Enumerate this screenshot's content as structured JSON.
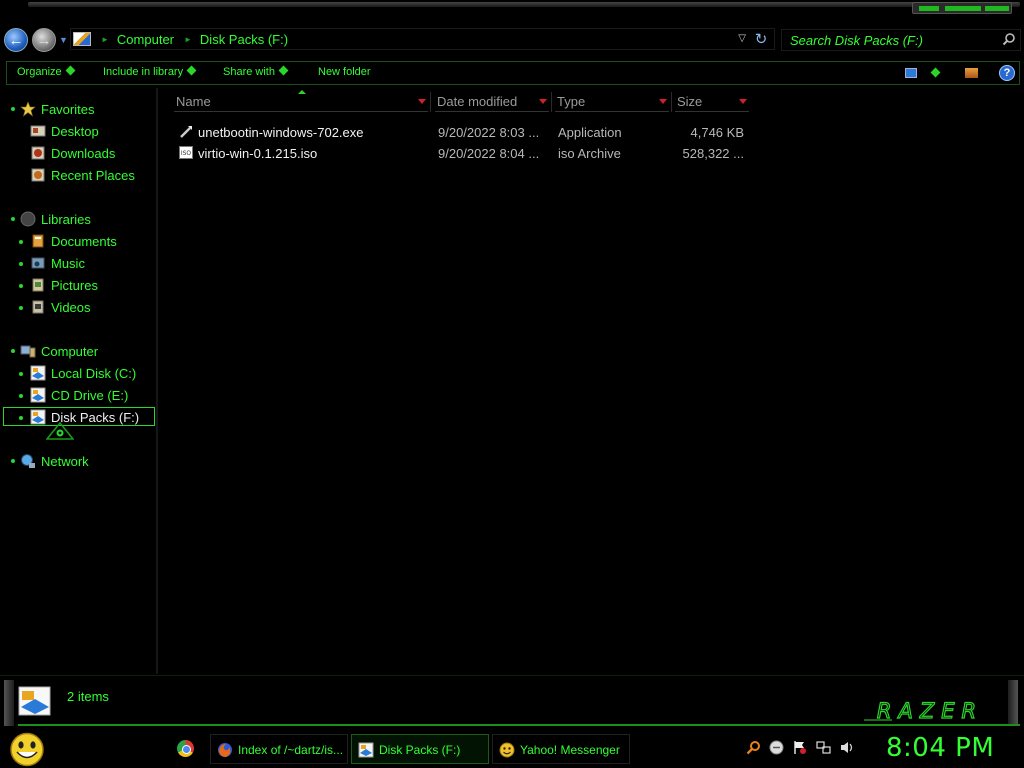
{
  "window": {
    "address_breadcrumbs": [
      "Computer",
      "Disk Packs (F:)"
    ],
    "search_placeholder": "Search Disk Packs (F:)"
  },
  "command_bar": {
    "organize": "Organize",
    "include_in_library": "Include in library",
    "share_with": "Share with",
    "new_folder": "New folder"
  },
  "nav": {
    "favorites": "Favorites",
    "desktop": "Desktop",
    "downloads": "Downloads",
    "recent_places": "Recent Places",
    "libraries": "Libraries",
    "documents": "Documents",
    "music": "Music",
    "pictures": "Pictures",
    "videos": "Videos",
    "computer": "Computer",
    "local_disk": "Local Disk (C:)",
    "cd_drive": "CD Drive (E:)",
    "disk_packs": "Disk Packs (F:)",
    "network": "Network",
    "selected_item": "Disk Packs (F:)"
  },
  "columns": {
    "name": "Name",
    "date_modified": "Date modified",
    "type": "Type",
    "size": "Size"
  },
  "files": [
    {
      "name": "unetbootin-windows-702.exe",
      "date": "9/20/2022 8:03 ...",
      "type": "Application",
      "size": "4,746 KB",
      "icon": "executable-icon"
    },
    {
      "name": "virtio-win-0.1.215.iso",
      "date": "9/20/2022 8:04 ...",
      "type": "iso Archive",
      "size": "528,322 ...",
      "icon": "iso-file-icon"
    }
  ],
  "status": {
    "item_count": "2 items",
    "brand_logo": "RAZER"
  },
  "taskbar": {
    "tasks": [
      {
        "label": "Index of /~dartz/is...",
        "icon": "firefox-icon",
        "active": false
      },
      {
        "label": "Disk Packs (F:)",
        "icon": "drive-icon",
        "active": true
      },
      {
        "label": "Yahoo! Messenger",
        "icon": "yahoo-messenger-icon",
        "active": false
      }
    ],
    "clock": "8:04 PM"
  },
  "colors": {
    "accent": "#33ff33",
    "background": "#000000",
    "header_arrow": "#d0202a"
  }
}
